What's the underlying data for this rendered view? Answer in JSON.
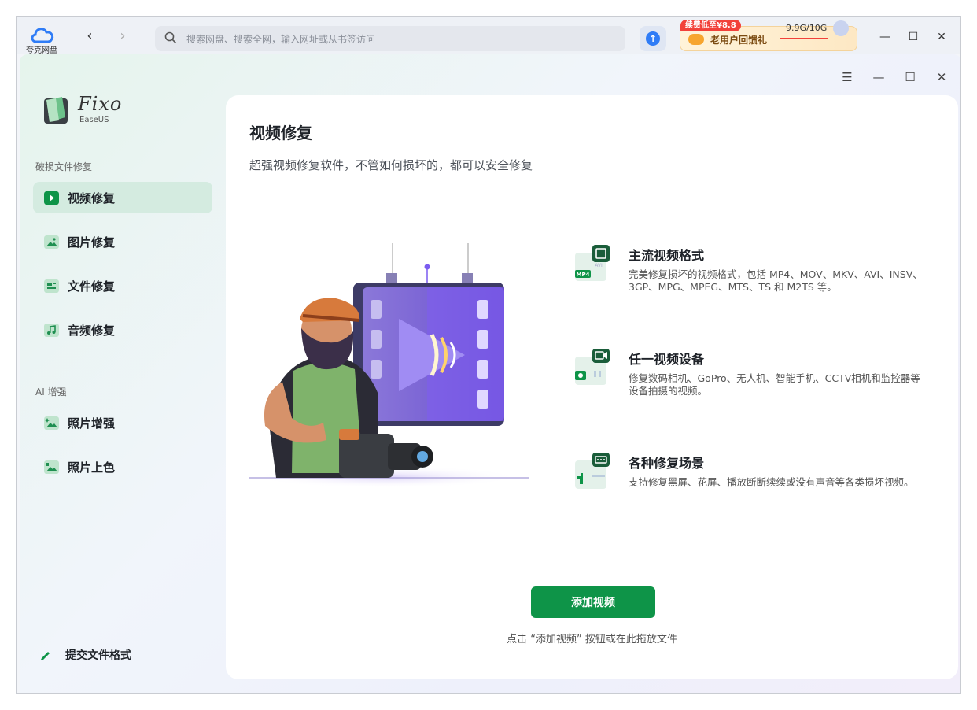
{
  "browser": {
    "app_name": "夸克网盘",
    "search_placeholder": "搜索网盘、搜索全网，输入网址或从书签访问",
    "promo_badge": "续费低至¥8.8",
    "promo_text": "老用户回馈礼",
    "storage": "9.9G/10G",
    "colors": {
      "accent": "#2f7cf6",
      "promo_badge": "#f2413a"
    }
  },
  "app": {
    "logo_name": "Fixo",
    "logo_sub": "EaseUS",
    "sidebar": {
      "section1": "破损文件修复",
      "items1": [
        {
          "label": "视频修复",
          "icon": "play-icon",
          "active": true
        },
        {
          "label": "图片修复",
          "icon": "image-icon",
          "active": false
        },
        {
          "label": "文件修复",
          "icon": "document-icon",
          "active": false
        },
        {
          "label": "音频修复",
          "icon": "music-icon",
          "active": false
        }
      ],
      "section2": "AI 增强",
      "items2": [
        {
          "label": "照片增强",
          "icon": "sparkle-image-icon"
        },
        {
          "label": "照片上色",
          "icon": "palette-image-icon"
        }
      ],
      "submit": "提交文件格式"
    },
    "main": {
      "title": "视频修复",
      "subtitle": "超强视频修复软件，不管如何损坏的，都可以安全修复",
      "features": [
        {
          "title": "主流视频格式",
          "desc": "完美修复损坏的视频格式，包括 MP4、MOV、MKV、AVI、INSV、3GP、MPG、MPEG、MTS、TS 和 M2TS 等。",
          "icon": "format-icon",
          "tag1": "MP4",
          "tag2": "AVI"
        },
        {
          "title": "任一视频设备",
          "desc": "修复数码相机、GoPro、无人机、智能手机、CCTV相机和监控器等设备拍摄的视频。",
          "icon": "device-icon"
        },
        {
          "title": "各种修复场景",
          "desc": "支持修复黑屏、花屏、播放断断续续或没有声音等各类损坏视频。",
          "icon": "scenario-icon"
        }
      ],
      "add_button": "添加视频",
      "hint": "点击 “添加视频” 按钮或在此拖放文件"
    },
    "colors": {
      "primary": "#0e9448",
      "active_bg": "#d4ebe0"
    }
  }
}
